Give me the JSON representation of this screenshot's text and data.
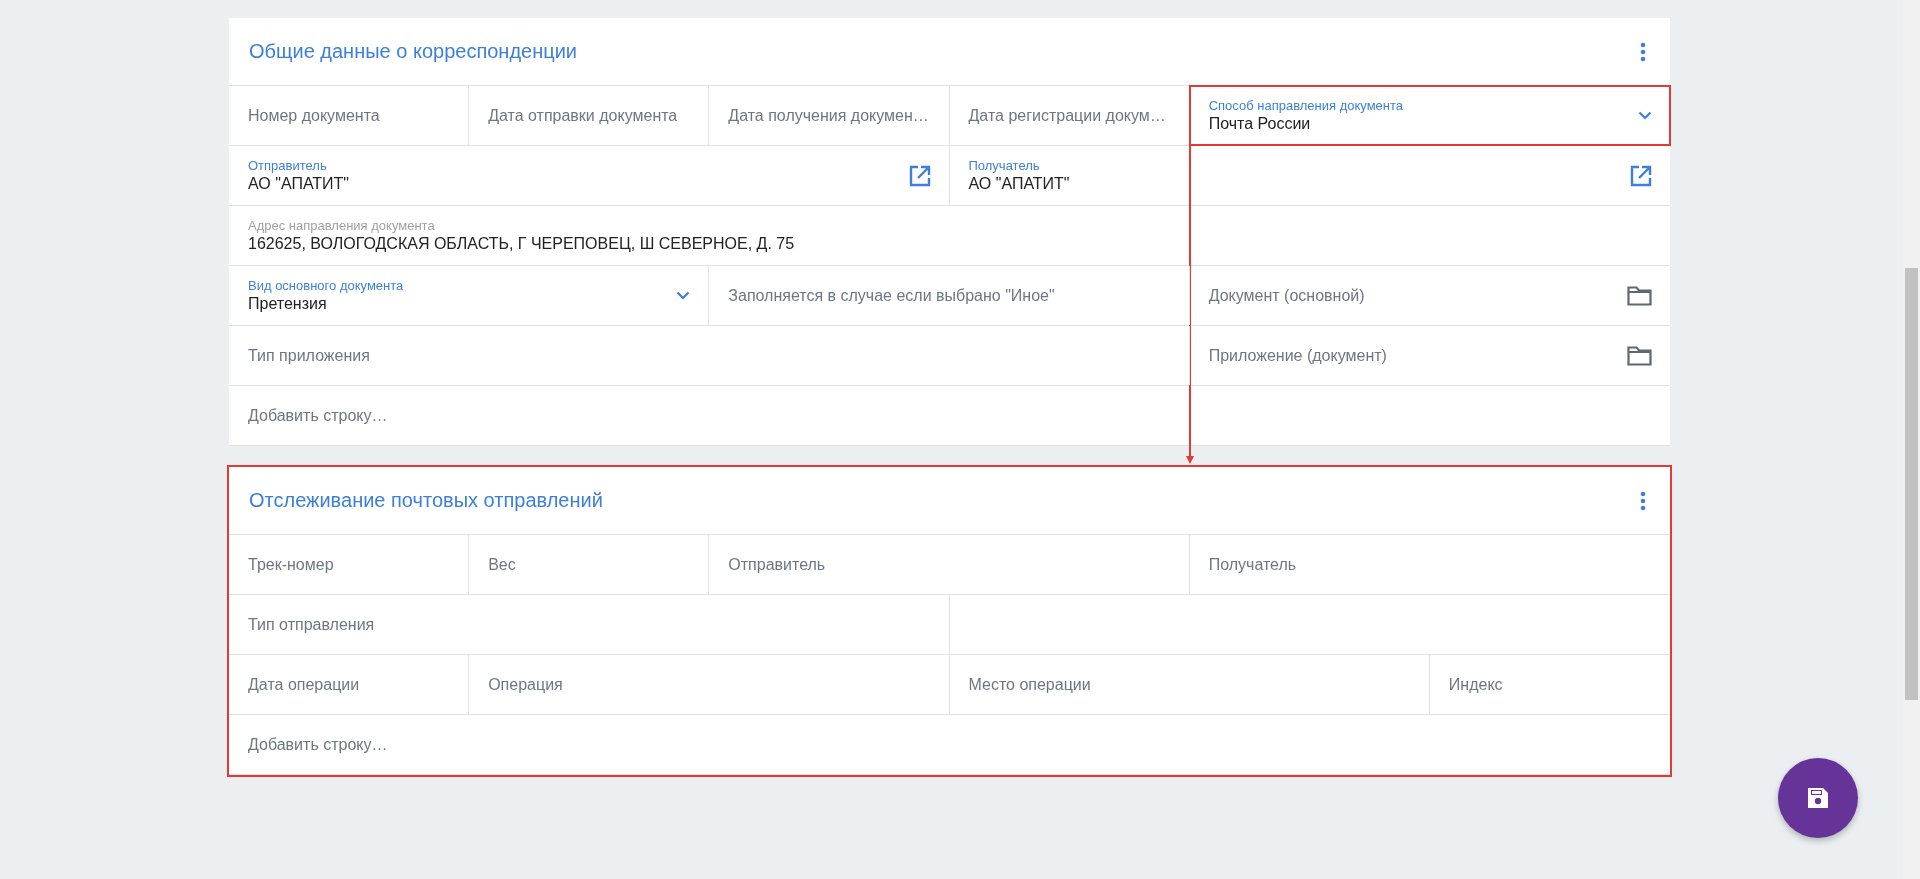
{
  "cards": [
    {
      "title": "Общие данные о корреспонденции",
      "highlighted": false,
      "lines": [
        [
          {
            "kind": "text",
            "label": "Номер документа"
          },
          {
            "kind": "text",
            "label": "Дата отправки документа"
          },
          {
            "kind": "text",
            "label": "Дата получения докумен…"
          },
          {
            "kind": "text",
            "label": "Дата регистрации докум…"
          },
          {
            "kind": "dropdown",
            "label": "Способ направления документа",
            "value": "Почта России",
            "disabled": false,
            "highlighted": true,
            "arrow_to_next": true
          }
        ],
        [
          {
            "kind": "link",
            "label": "Отправитель",
            "value": "АО \"АПАТИТ\"",
            "disabled": false
          },
          {
            "kind": "link",
            "label": "Получатель",
            "value": "АО \"АПАТИТ\"",
            "disabled": false
          }
        ],
        [
          {
            "kind": "text",
            "label": "Адрес направления документа",
            "value": "162625, ВОЛОГОДСКАЯ ОБЛАСТЬ, Г ЧЕРЕПОВЕЦ, Ш СЕВЕРНОЕ, Д. 75",
            "disabled": true
          }
        ],
        [
          {
            "kind": "dropdown",
            "label": "Вид основного документа",
            "value": "Претензия",
            "disabled": false
          },
          {
            "kind": "text",
            "label": "Заполняется в случае если выбрано \"Иное\""
          },
          {
            "kind": "folder",
            "label": "Документ (основной)"
          }
        ],
        [
          {
            "kind": "text",
            "label": "Тип приложения"
          },
          {
            "kind": "folder",
            "label": "Приложение (документ)"
          }
        ],
        [
          {
            "kind": "add",
            "label": "Добавить строку…"
          }
        ]
      ]
    },
    {
      "title": "Отслеживание почтовых отправлений",
      "highlighted": true,
      "lines": [
        [
          {
            "kind": "text",
            "label": "Трек-номер"
          },
          {
            "kind": "text",
            "label": "Вес"
          },
          {
            "kind": "text",
            "label": "Отправитель"
          },
          {
            "kind": "text",
            "label": "Получатель"
          }
        ],
        [
          {
            "kind": "text",
            "label": "Тип отправления"
          },
          {
            "kind": "empty"
          }
        ],
        [
          {
            "kind": "text",
            "label": "Дата операции"
          },
          {
            "kind": "text",
            "label": "Операция"
          },
          {
            "kind": "text",
            "label": "Место операции"
          },
          {
            "kind": "text",
            "label": "Индекс"
          }
        ],
        [
          {
            "kind": "add",
            "label": "Добавить строку…"
          }
        ]
      ]
    }
  ]
}
